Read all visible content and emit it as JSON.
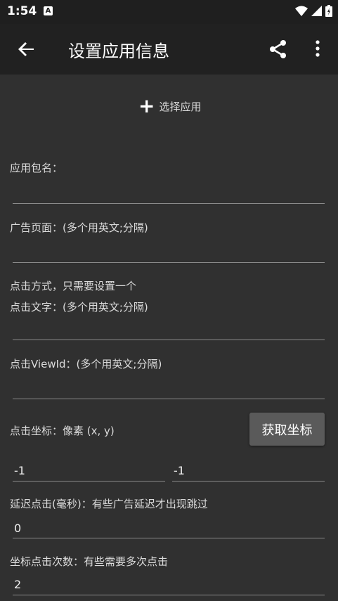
{
  "status": {
    "time": "1:54",
    "notification_glyph": "A"
  },
  "appbar": {
    "title": "设置应用信息"
  },
  "select_app": {
    "label": "选择应用"
  },
  "labels": {
    "package_name": "应用包名：",
    "ad_page": "广告页面：(多个用英文;分隔)",
    "click_method": "点击方式，只需要设置一个",
    "click_text": "点击文字：(多个用英文;分隔)",
    "click_viewid": "点击ViewId：(多个用英文;分隔)",
    "click_coord": "点击坐标：像素 (x, y)",
    "delay": "延迟点击(毫秒)：有些广告延迟才出现跳过",
    "click_count": "坐标点击次数：有些需要多次点击"
  },
  "buttons": {
    "get_coord": "获取坐标"
  },
  "fields": {
    "package_name": "",
    "ad_page": "",
    "click_text": "",
    "click_viewid": "",
    "coord_x": "-1",
    "coord_y": "-1",
    "delay": "0",
    "click_count": "2"
  },
  "icons": {
    "back": "arrow-left-icon",
    "share": "share-icon",
    "more": "more-vert-icon",
    "add": "plus-icon"
  }
}
